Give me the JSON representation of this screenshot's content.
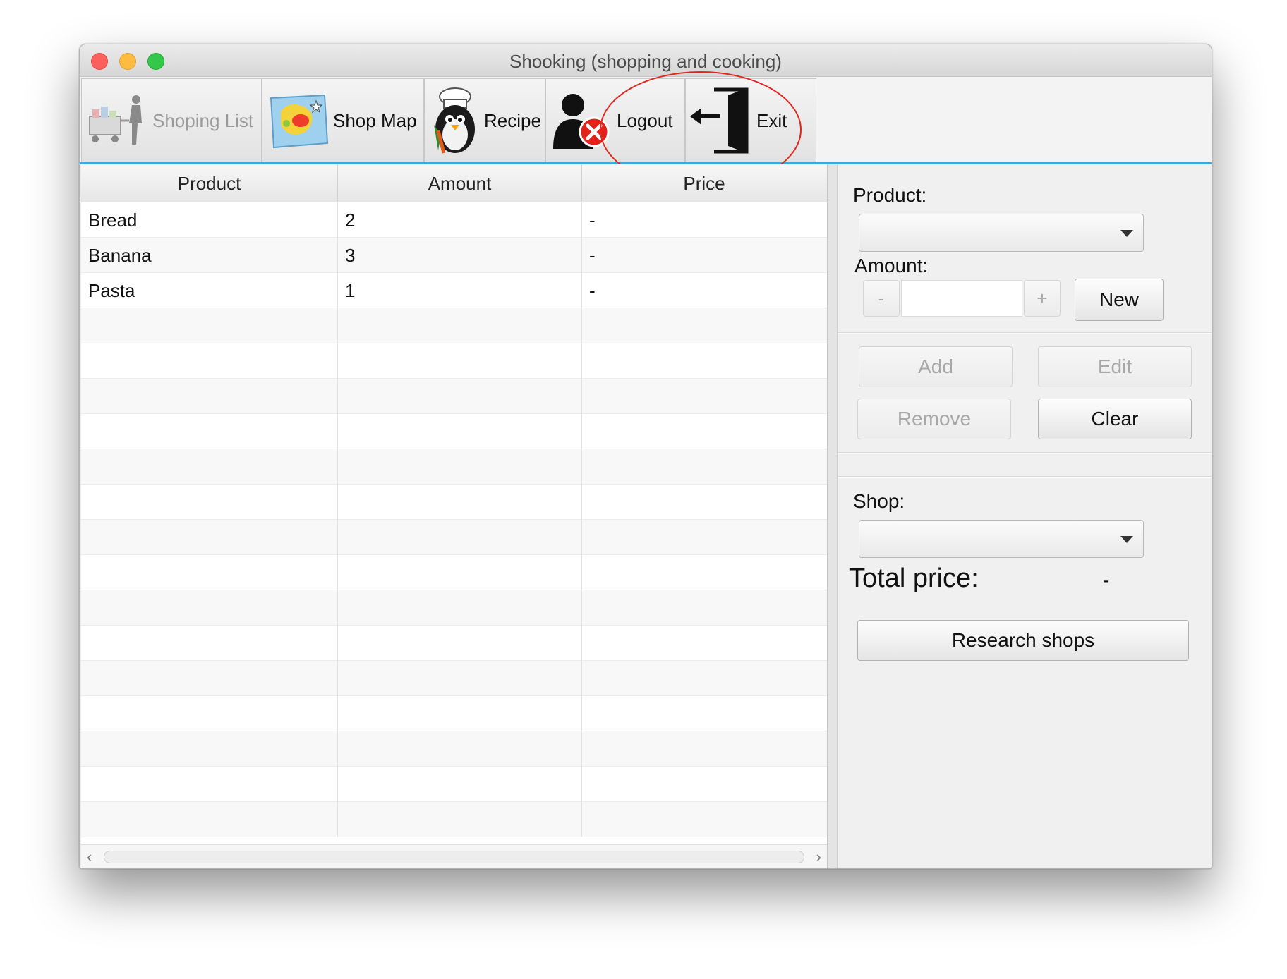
{
  "window": {
    "title": "Shooking (shopping and cooking)"
  },
  "tabs": [
    {
      "label": "Shoping List",
      "icon": "shopping-cart-person-icon",
      "disabled": true
    },
    {
      "label": "Shop Map",
      "icon": "map-icon",
      "disabled": false
    },
    {
      "label": "Recipe",
      "icon": "chef-penguin-icon",
      "disabled": false
    },
    {
      "label": "Logout",
      "icon": "user-logout-icon",
      "disabled": false
    },
    {
      "label": "Exit",
      "icon": "exit-door-icon",
      "disabled": false
    }
  ],
  "table": {
    "columns": [
      "Product",
      "Amount",
      "Price"
    ],
    "rows": [
      [
        "Bread",
        "2",
        "-"
      ],
      [
        "Banana",
        "3",
        "-"
      ],
      [
        "Pasta",
        "1",
        "-"
      ]
    ],
    "empty_rows": 15
  },
  "panel": {
    "product_label": "Product:",
    "product_value": "",
    "amount_label": "Amount:",
    "amount_value": "",
    "minus": "-",
    "plus": "+",
    "new_button": "New",
    "add_button": "Add",
    "edit_button": "Edit",
    "remove_button": "Remove",
    "clear_button": "Clear",
    "shop_label": "Shop:",
    "shop_value": "",
    "total_label": "Total price:",
    "total_value": "-",
    "research_button": "Research shops"
  },
  "colors": {
    "accent": "#3ba9da",
    "annotation": "#e0261f"
  }
}
